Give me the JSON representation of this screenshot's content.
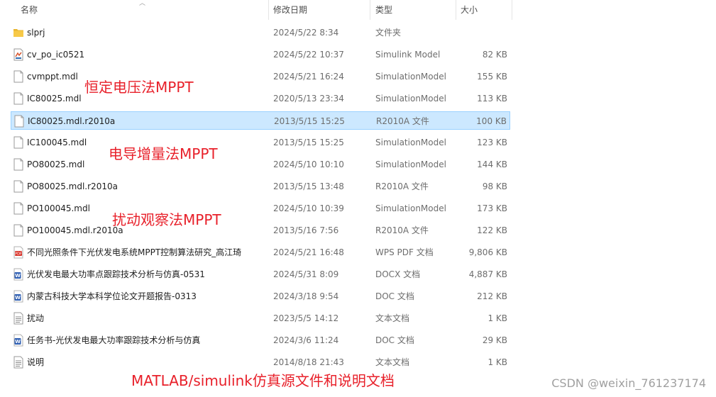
{
  "columns": {
    "name": "名称",
    "date": "修改日期",
    "type": "类型",
    "size": "大小"
  },
  "files": [
    {
      "name": "slprj",
      "date": "2024/5/22 8:34",
      "type": "文件夹",
      "size": "",
      "icon": "folder-icon"
    },
    {
      "name": "cv_po_ic0521",
      "date": "2024/5/22 10:37",
      "type": "Simulink Model",
      "size": "82 KB",
      "icon": "simulink-file-icon"
    },
    {
      "name": "cvmppt.mdl",
      "date": "2024/5/21 16:24",
      "type": "SimulationModel",
      "size": "155 KB",
      "icon": "blank-file-icon"
    },
    {
      "name": "IC80025.mdl",
      "date": "2020/5/13 23:34",
      "type": "SimulationModel",
      "size": "113 KB",
      "icon": "blank-file-icon"
    },
    {
      "name": "IC80025.mdl.r2010a",
      "date": "2013/5/15 15:25",
      "type": "R2010A 文件",
      "size": "100 KB",
      "icon": "blank-file-icon"
    },
    {
      "name": "IC100045.mdl",
      "date": "2013/5/15 15:25",
      "type": "SimulationModel",
      "size": "123 KB",
      "icon": "blank-file-icon"
    },
    {
      "name": "PO80025.mdl",
      "date": "2024/5/10 10:10",
      "type": "SimulationModel",
      "size": "144 KB",
      "icon": "blank-file-icon"
    },
    {
      "name": "PO80025.mdl.r2010a",
      "date": "2013/5/15 13:48",
      "type": "R2010A 文件",
      "size": "98 KB",
      "icon": "blank-file-icon"
    },
    {
      "name": "PO100045.mdl",
      "date": "2024/5/10 10:39",
      "type": "SimulationModel",
      "size": "173 KB",
      "icon": "blank-file-icon"
    },
    {
      "name": "PO100045.mdl.r2010a",
      "date": "2013/5/16 7:56",
      "type": "R2010A 文件",
      "size": "122 KB",
      "icon": "blank-file-icon"
    },
    {
      "name": "不同光照条件下光伏发电系统MPPT控制算法研究_高江琦",
      "date": "2024/5/21 16:48",
      "type": "WPS PDF 文档",
      "size": "9,806 KB",
      "icon": "pdf-file-icon"
    },
    {
      "name": "光伏发电最大功率点跟踪技术分析与仿真-0531",
      "date": "2024/5/31 8:09",
      "type": "DOCX 文档",
      "size": "4,887 KB",
      "icon": "word-file-icon"
    },
    {
      "name": "内蒙古科技大学本科学位论文开题报告-0313",
      "date": "2024/3/18 9:54",
      "type": "DOC 文档",
      "size": "212 KB",
      "icon": "word-file-icon"
    },
    {
      "name": "扰动",
      "date": "2023/5/5 14:12",
      "type": "文本文档",
      "size": "1 KB",
      "icon": "text-file-icon"
    },
    {
      "name": "任务书-光伏发电最大功率跟踪技术分析与仿真",
      "date": "2024/3/6 11:24",
      "type": "DOC 文档",
      "size": "29 KB",
      "icon": "word-file-icon"
    },
    {
      "name": "说明",
      "date": "2014/8/18 21:43",
      "type": "文本文档",
      "size": "1 KB",
      "icon": "text-file-icon"
    }
  ],
  "selected_file": "IC80025.mdl.r2010a",
  "annotations": {
    "a1": "恒定电压法MPPT",
    "a2": "电导增量法MPPT",
    "a3": "扰动观察法MPPT",
    "a4": "MATLAB/simulink仿真源文件和说明文档"
  },
  "watermark": "CSDN @weixin_761237174",
  "colors": {
    "annotation": "#e8202a",
    "selection": "#cce8ff",
    "folder": "#f7c948"
  }
}
